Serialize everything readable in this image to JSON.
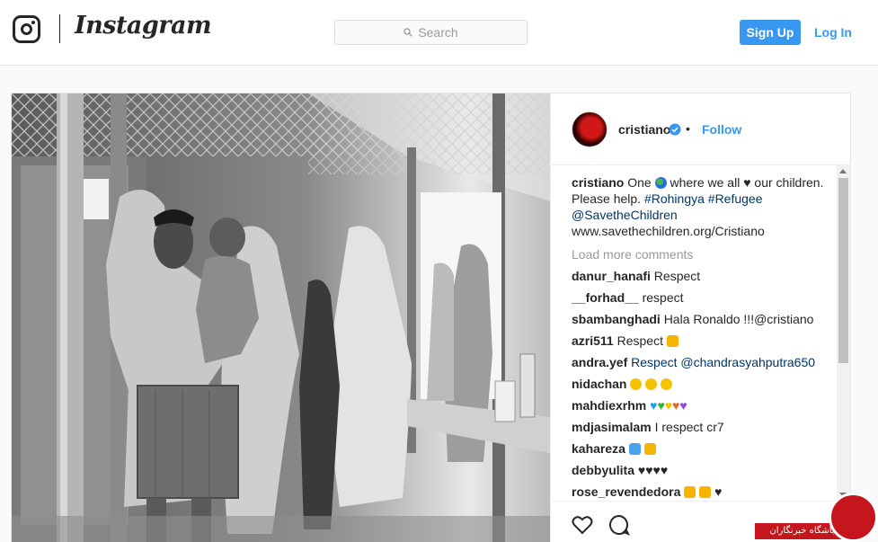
{
  "header": {
    "brand": "Instagram",
    "search_placeholder": "Search",
    "signup_label": "Sign Up",
    "login_label": "Log In"
  },
  "post": {
    "photo_description_icon": "photo",
    "username": "cristiano",
    "separator": "•",
    "follow_label": "Follow",
    "caption": {
      "user": "cristiano",
      "text_1": "One",
      "text_2": "where we all",
      "text_3": "our children. Please help.",
      "hashtag_1": "#Rohingya",
      "hashtag_2": "#Refugee",
      "mention": "@SavetheChildren",
      "url": "www.savethechildren.org/Cristiano"
    },
    "load_more": "Load more comments",
    "comments": [
      {
        "user": "danur_hanafi",
        "text": "Respect"
      },
      {
        "user": "__forhad__",
        "text": "respect"
      },
      {
        "user": "sbambanghadi",
        "text": "Hala Ronaldo !!!@cristiano"
      },
      {
        "user": "azri511",
        "text": "Respect"
      },
      {
        "user": "andra.yef",
        "text": "Respect @chandrasyahputra650"
      },
      {
        "user": "nidachan",
        "text": ""
      },
      {
        "user": "mahdiexrhm",
        "text": ""
      },
      {
        "user": "mdjasimalam",
        "text": "I respect cr7"
      },
      {
        "user": "kahareza",
        "text": ""
      },
      {
        "user": "debbyulita",
        "text": "♥♥♥♥"
      },
      {
        "user": "rose_revendedora",
        "text": ""
      }
    ]
  },
  "watermark": {
    "text": "باشگاه خبرنگاران"
  },
  "colors": {
    "accent": "#3897f0",
    "hashtag": "#003569",
    "watermark": "#c4161c"
  }
}
